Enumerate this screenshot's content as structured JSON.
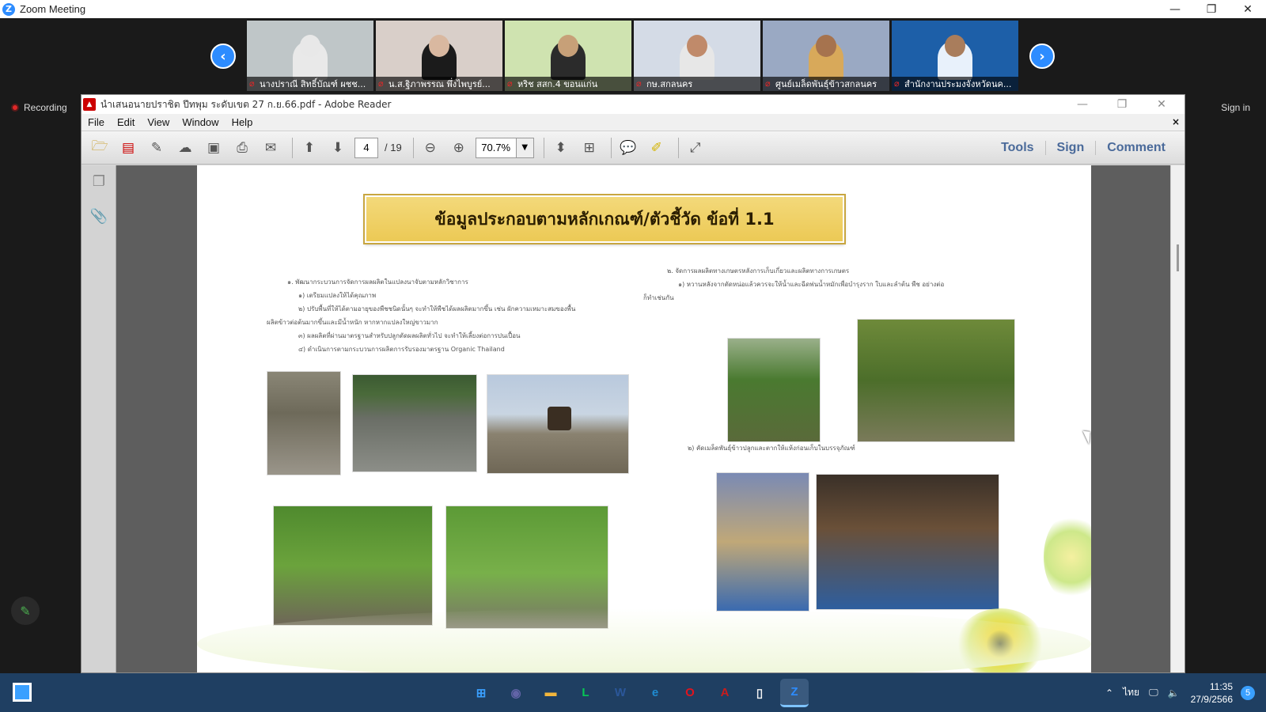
{
  "window": {
    "title": "Zoom Meeting",
    "controls": {
      "minimize": "—",
      "restore": "❐",
      "close": "✕"
    }
  },
  "meeting": {
    "recording_label": "Recording",
    "signin_label": "Sign in",
    "prev_icon": "chevron-left-icon",
    "next_icon": "chevron-right-icon",
    "participants": [
      {
        "name": "นางปราณี สิทธิ์บัณฑ์ ผชช...",
        "bg": "#bfc6c8",
        "shirt": "#e9e9e9",
        "skin": "#e8e8e8"
      },
      {
        "name": "น.ส.ฐิภาพรรณ พึ่งไพบูรย์...",
        "bg": "#d9cfc9",
        "shirt": "#1b1b1b",
        "skin": "#d9b8a0"
      },
      {
        "name": "หริช สสก.4 ขอนแก่น",
        "bg": "#cfe3b0",
        "shirt": "#2b2b2b",
        "skin": "#c7a078"
      },
      {
        "name": "กษ.สกลนคร",
        "bg": "#d4dbe6",
        "shirt": "#e7e7e7",
        "skin": "#c08a6a"
      },
      {
        "name": "ศูนย์เมล็ดพันธุ์ข้าวสกลนคร",
        "bg": "#9aa9c3",
        "shirt": "#d8a95a",
        "skin": "#a6734e"
      },
      {
        "name": "สำนักงานประมงจังหวัดนค...",
        "bg": "#1d5fa8",
        "shirt": "#e8f1fb",
        "skin": "#a97d5c"
      }
    ]
  },
  "reader": {
    "title": "นำเสนอนายปราชิต ปีทพุม ระดับเขต 27 ก.ย.66.pdf - Adobe Reader",
    "menu": [
      "File",
      "Edit",
      "View",
      "Window",
      "Help"
    ],
    "menu_close": "×",
    "page_current": "4",
    "page_total": "/ 19",
    "zoom": "70.7%",
    "tools_label": "Tools",
    "sign_label": "Sign",
    "comment_label": "Comment"
  },
  "slide": {
    "title": "ข้อมูลประกอบตามหลักเกณฑ์/ตัวชี้วัด ข้อที่ 1.1",
    "left_text": [
      "๑. พัฒนากระบวนการจัดการผลผลิตในแปลงนาจับตามหลักวิชาการ",
      "๑) เตรียมแปลงให้ได้คุณภาพ",
      "๒) ปรับพื้นที่ให้ได้ตามอายุของพืชชนิดนั้นๆ จะทำให้พืชได้ผลผลิตมากขึ้น เช่น ผักความเหมาะสมของพื้น",
      "ผลิตข้าวต่อต้นมากขึ้นและมีน้ำหนัก หากหากแปลงใหญ่ขาวมาก",
      "๓) ผลผลิตที่ผ่านมาตรฐานสำหรับปลูกตัดผลผลิตทั่วไป จะทำให้เลี้ยงต่อการปนเปื้อน",
      "๔) ดำเนินการตามกระบวนการผลิตการรับรองมาตรฐาน Organic Thailand"
    ],
    "right_text_1": [
      "๒. จัดการผลผลิตทางเกษตรหลังการเก็บเกี่ยวและผลิตทางการเกษตร",
      "๑) หวานหลังจากตัดหน่อแล้วควรจะให้น้ำและฉีดพ่นน้ำหมักเพื่อบำรุงราก ใบและลำต้น พืช อย่างต่อ",
      "ก็ทำเช่นกัน"
    ],
    "right_text_2": "๒) คัดเมล็ดพันธุ์ข้าวปลูกและตากให้แห้งก่อนเก็บในบรรจุภัณฑ์"
  },
  "taskbar": {
    "apps": [
      {
        "icon": "windows-start-icon",
        "label": "⊞",
        "color": "#3aa0ff"
      },
      {
        "icon": "teams-icon",
        "label": "◉",
        "color": "#6264a7"
      },
      {
        "icon": "file-explorer-icon",
        "label": "▬",
        "color": "#f2b63c"
      },
      {
        "icon": "line-icon",
        "label": "L",
        "color": "#06c755"
      },
      {
        "icon": "word-icon",
        "label": "W",
        "color": "#2b579a"
      },
      {
        "icon": "edge-icon",
        "label": "e",
        "color": "#1f8bd1"
      },
      {
        "icon": "opera-icon",
        "label": "O",
        "color": "#e0141e"
      },
      {
        "icon": "acrobat-icon",
        "label": "A",
        "color": "#c81c1c"
      },
      {
        "icon": "document-icon",
        "label": "▯",
        "color": "#f4f4f4"
      },
      {
        "icon": "zoom-icon",
        "label": "Z",
        "color": "#2d8cff"
      }
    ],
    "lang": "ไทย",
    "time": "11:35",
    "date": "27/9/2566",
    "notifications": "5"
  }
}
